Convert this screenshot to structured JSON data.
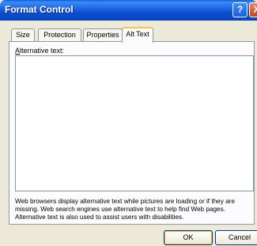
{
  "window": {
    "title": "Format Control",
    "help_label": "?",
    "close_label": "X"
  },
  "tabs": [
    {
      "label": "Size"
    },
    {
      "label": "Protection"
    },
    {
      "label": "Properties"
    },
    {
      "label": "Alt Text"
    }
  ],
  "alt_text": {
    "label_accel": "A",
    "label_rest": "lternative text:",
    "value": "",
    "description": "Web browsers display alternative text while pictures are loading or if they are missing.  Web search engines use alternative text to help find Web pages. Alternative text is also used to assist users with disabilities."
  },
  "buttons": {
    "ok": "OK",
    "cancel": "Cancel"
  }
}
